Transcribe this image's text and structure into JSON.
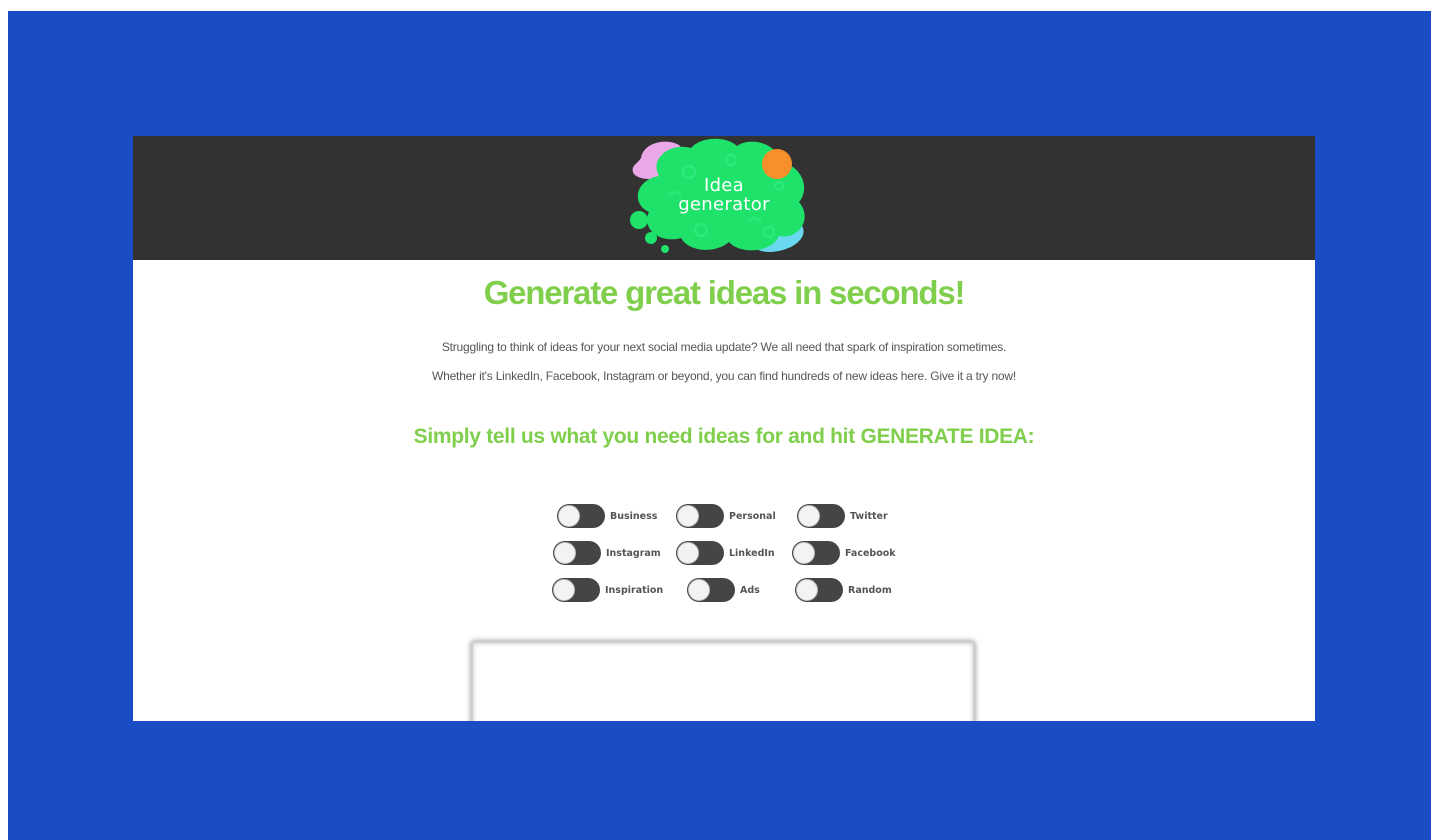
{
  "colors": {
    "backdrop": "#1a4cc6",
    "header": "#323232",
    "accent_green": "#80cf4c",
    "logo_green": "#1fe26b",
    "logo_orange": "#f7902a",
    "logo_pink": "#eaa8e8",
    "logo_blue": "#6ad8f0",
    "toggle_track": "#454545"
  },
  "logo": {
    "line1": "Idea",
    "line2": "generator",
    "icon": "idea-generator-logo"
  },
  "headline": "Generate great ideas in seconds!",
  "intro": {
    "line1": "Struggling to think of ideas for your next social media update? We all need that spark of inspiration sometimes.",
    "line2": "Whether it's LinkedIn, Facebook, Instagram or beyond, you can find hundreds of new ideas here. Give it a try now!"
  },
  "subhead": "Simply tell us what you need ideas for and hit GENERATE IDEA:",
  "toggles": [
    {
      "label": "Business",
      "on": false
    },
    {
      "label": "Personal",
      "on": false
    },
    {
      "label": "Twitter",
      "on": false
    },
    {
      "label": "Instagram",
      "on": false
    },
    {
      "label": "LinkedIn",
      "on": false
    },
    {
      "label": "Facebook",
      "on": false
    },
    {
      "label": "Inspiration",
      "on": false
    },
    {
      "label": "Ads",
      "on": false
    },
    {
      "label": "Random",
      "on": false
    }
  ],
  "idea_output": {
    "text": ""
  }
}
